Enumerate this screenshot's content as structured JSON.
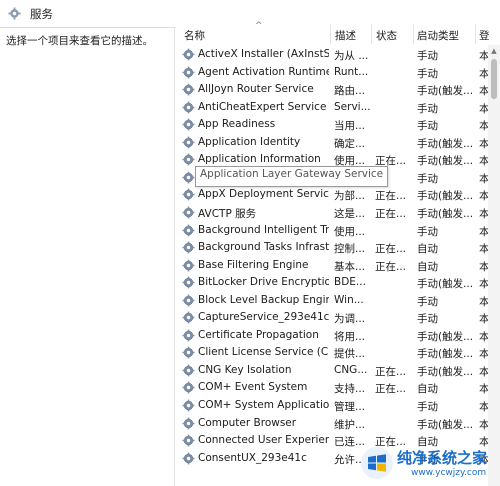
{
  "window": {
    "title": "服务"
  },
  "left_pane": {
    "description": "选择一个项目来查看它的描述。"
  },
  "columns": {
    "name": "名称",
    "desc": "描述",
    "status": "状态",
    "startup": "启动类型",
    "logon": "登"
  },
  "tooltip": "Application Layer Gateway Service",
  "services": [
    {
      "name": "ActiveX Installer (AxInstSV)",
      "desc": "为从 ...",
      "status": "",
      "startup": "手动",
      "logon": "本"
    },
    {
      "name": "Agent Activation Runtime_...",
      "desc": "Runt...",
      "status": "",
      "startup": "手动",
      "logon": "本"
    },
    {
      "name": "AllJoyn Router Service",
      "desc": "路由...",
      "status": "",
      "startup": "手动(触发...",
      "logon": "本"
    },
    {
      "name": "AntiCheatExpert Service",
      "desc": "Servi...",
      "status": "",
      "startup": "手动",
      "logon": "本"
    },
    {
      "name": "App Readiness",
      "desc": "当用...",
      "status": "",
      "startup": "手动",
      "logon": "本"
    },
    {
      "name": "Application Identity",
      "desc": "确定...",
      "status": "",
      "startup": "手动(触发...",
      "logon": "本"
    },
    {
      "name": "Application Information",
      "desc": "使用...",
      "status": "正在...",
      "startup": "手动(触发...",
      "logon": "本"
    },
    {
      "name": "Application Layer Gateway Service",
      "desc": "",
      "status": "",
      "startup": "手动",
      "logon": "本"
    },
    {
      "name": "AppX Deployment Service ...",
      "desc": "为部...",
      "status": "正在...",
      "startup": "手动(触发...",
      "logon": "本"
    },
    {
      "name": "AVCTP 服务",
      "desc": "这是...",
      "status": "正在...",
      "startup": "手动(触发...",
      "logon": "本"
    },
    {
      "name": "Background Intelligent Tra...",
      "desc": "使用...",
      "status": "",
      "startup": "手动",
      "logon": "本"
    },
    {
      "name": "Background Tasks Infrastru...",
      "desc": "控制...",
      "status": "正在...",
      "startup": "自动",
      "logon": "本"
    },
    {
      "name": "Base Filtering Engine",
      "desc": "基本...",
      "status": "正在...",
      "startup": "自动",
      "logon": "本"
    },
    {
      "name": "BitLocker Drive Encryption ...",
      "desc": "BDE...",
      "status": "",
      "startup": "手动(触发...",
      "logon": "本"
    },
    {
      "name": "Block Level Backup Engine ...",
      "desc": "Win...",
      "status": "",
      "startup": "手动",
      "logon": "本"
    },
    {
      "name": "CaptureService_293e41c",
      "desc": "为调...",
      "status": "",
      "startup": "手动",
      "logon": "本"
    },
    {
      "name": "Certificate Propagation",
      "desc": "将用...",
      "status": "",
      "startup": "手动(触发...",
      "logon": "本"
    },
    {
      "name": "Client License Service (Clip...",
      "desc": "提供...",
      "status": "",
      "startup": "手动(触发...",
      "logon": "本"
    },
    {
      "name": "CNG Key Isolation",
      "desc": "CNG...",
      "status": "正在...",
      "startup": "手动(触发...",
      "logon": "本"
    },
    {
      "name": "COM+ Event System",
      "desc": "支持...",
      "status": "正在...",
      "startup": "自动",
      "logon": "本"
    },
    {
      "name": "COM+ System Application",
      "desc": "管理...",
      "status": "",
      "startup": "手动",
      "logon": "本"
    },
    {
      "name": "Computer Browser",
      "desc": "维护...",
      "status": "",
      "startup": "手动(触发...",
      "logon": "本"
    },
    {
      "name": "Connected User Experienc...",
      "desc": "已连...",
      "status": "正在...",
      "startup": "自动",
      "logon": "本"
    },
    {
      "name": "ConsentUX_293e41c",
      "desc": "允许...",
      "status": "",
      "startup": "手动",
      "logon": "本"
    }
  ],
  "watermark": {
    "brand": "纯净系统之家",
    "url": "www.ycwjzy.com"
  }
}
